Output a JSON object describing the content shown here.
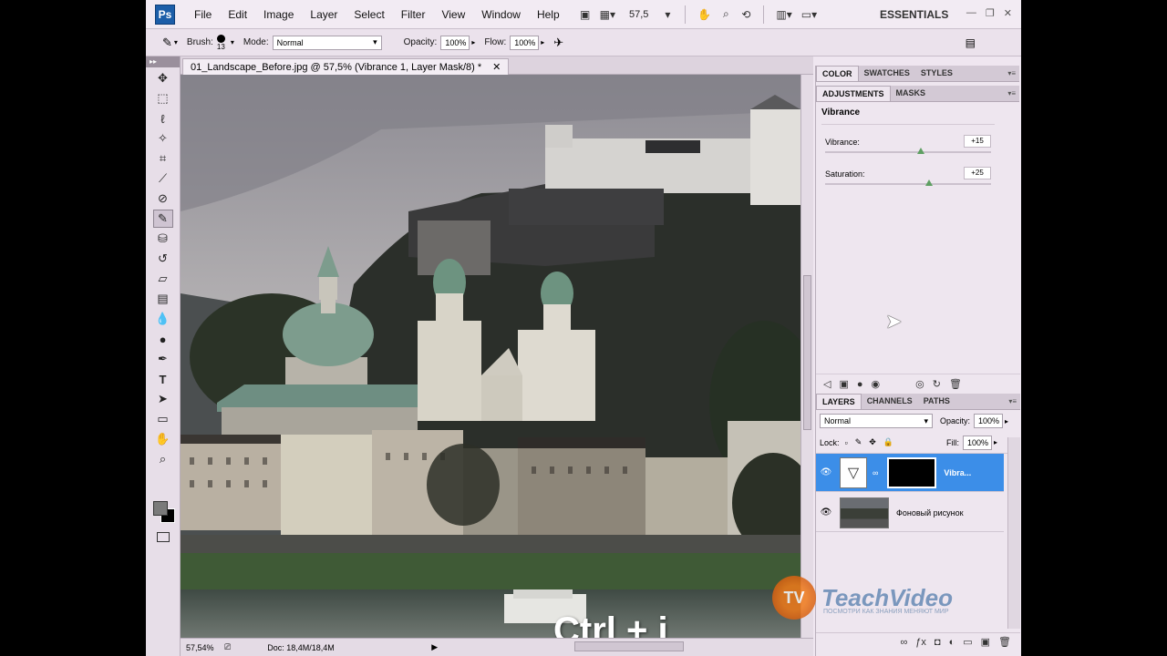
{
  "app": {
    "logo": "Ps",
    "workspace": "ESSENTIALS",
    "zoom": "57,5"
  },
  "menu": [
    "File",
    "Edit",
    "Image",
    "Layer",
    "Select",
    "Filter",
    "View",
    "Window",
    "Help"
  ],
  "options": {
    "brush_label": "Brush:",
    "brush_size": "13",
    "mode_label": "Mode:",
    "mode_value": "Normal",
    "opacity_label": "Opacity:",
    "opacity_value": "100%",
    "flow_label": "Flow:",
    "flow_value": "100%"
  },
  "document": {
    "tab_title": "01_Landscape_Before.jpg @ 57,5% (Vibrance 1, Layer Mask/8) *",
    "status_zoom": "57,54%",
    "status_doc": "Doc: 18,4M/18,4M"
  },
  "overlay": {
    "shortcut": "Ctrl + i"
  },
  "panels": {
    "color_tabs": [
      "COLOR",
      "SWATCHES",
      "STYLES"
    ],
    "adj_tabs": [
      "ADJUSTMENTS",
      "MASKS"
    ],
    "adj_title": "Vibrance",
    "vibrance": {
      "label": "Vibrance:",
      "value": "+15",
      "fraction": 0.575
    },
    "saturation": {
      "label": "Saturation:",
      "value": "+25",
      "fraction": 0.625
    },
    "layer_tabs": [
      "LAYERS",
      "CHANNELS",
      "PATHS"
    ],
    "blend_mode": "Normal",
    "opacity_label": "Opacity:",
    "opacity_value": "100%",
    "lock_label": "Lock:",
    "fill_label": "Fill:",
    "fill_value": "100%",
    "layers": [
      {
        "name": "Vibra...",
        "selected": true
      },
      {
        "name": "Фоновый рисунок",
        "selected": false
      }
    ]
  },
  "watermark": {
    "logo": "TV",
    "brand": "TeachVideo",
    "tagline": "ПОСМОТРИ КАК ЗНАНИЯ МЕНЯЮТ МИР"
  },
  "colors": {
    "selection": "#3c8ee8",
    "ps_blue": "#1c5ea8",
    "panel_bg": "#eee6ef"
  }
}
